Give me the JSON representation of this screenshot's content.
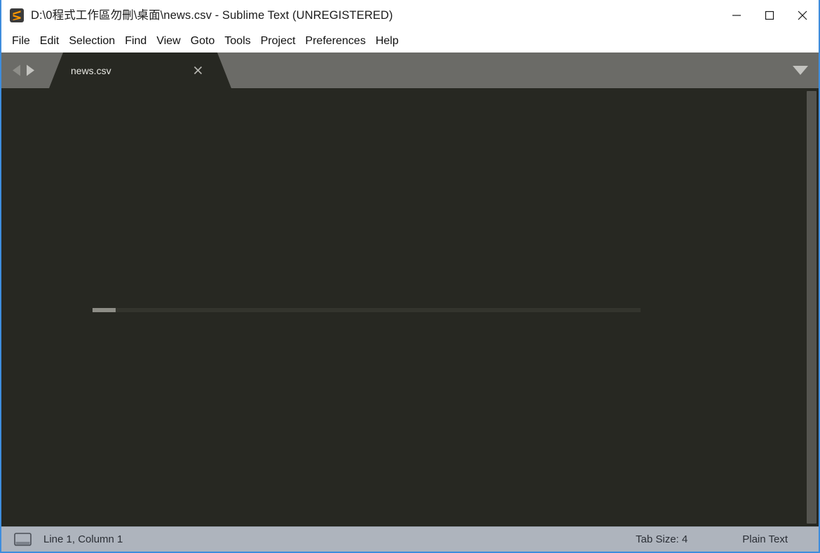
{
  "window": {
    "title": "D:\\0程式工作區勿刪\\桌面\\news.csv - Sublime Text (UNREGISTERED)",
    "app_icon": "sublime-text-icon",
    "accent_border_color": "#3e8ddd",
    "controls": {
      "minimize": "minimize-icon",
      "maximize": "maximize-icon",
      "close": "close-icon"
    }
  },
  "menubar": {
    "items": [
      {
        "label": "File"
      },
      {
        "label": "Edit"
      },
      {
        "label": "Selection"
      },
      {
        "label": "Find"
      },
      {
        "label": "View"
      },
      {
        "label": "Goto"
      },
      {
        "label": "Tools"
      },
      {
        "label": "Project"
      },
      {
        "label": "Preferences"
      },
      {
        "label": "Help"
      }
    ]
  },
  "tabbar": {
    "background_color": "#6b6b67",
    "nav": {
      "back_icon": "triangle-left-icon",
      "forward_icon": "triangle-right-icon"
    },
    "tabs": [
      {
        "label": "news.csv",
        "active": true,
        "close_icon": "close-icon"
      }
    ],
    "overflow_menu_icon": "chevron-down-icon"
  },
  "editor": {
    "background_color": "#272822",
    "content": "",
    "progress_bar": {
      "visible": true,
      "track_color": "#33342d",
      "fill_color": "#8d8d86",
      "fill_percent": 4
    },
    "scrollbar": {
      "thumb_color": "#555550"
    }
  },
  "statusbar": {
    "background_color": "#aeb4bd",
    "sidebar_toggle_icon": "sidebar-toggle-icon",
    "cursor_position": "Line 1, Column 1",
    "tab_size": "Tab Size: 4",
    "syntax": "Plain Text"
  }
}
